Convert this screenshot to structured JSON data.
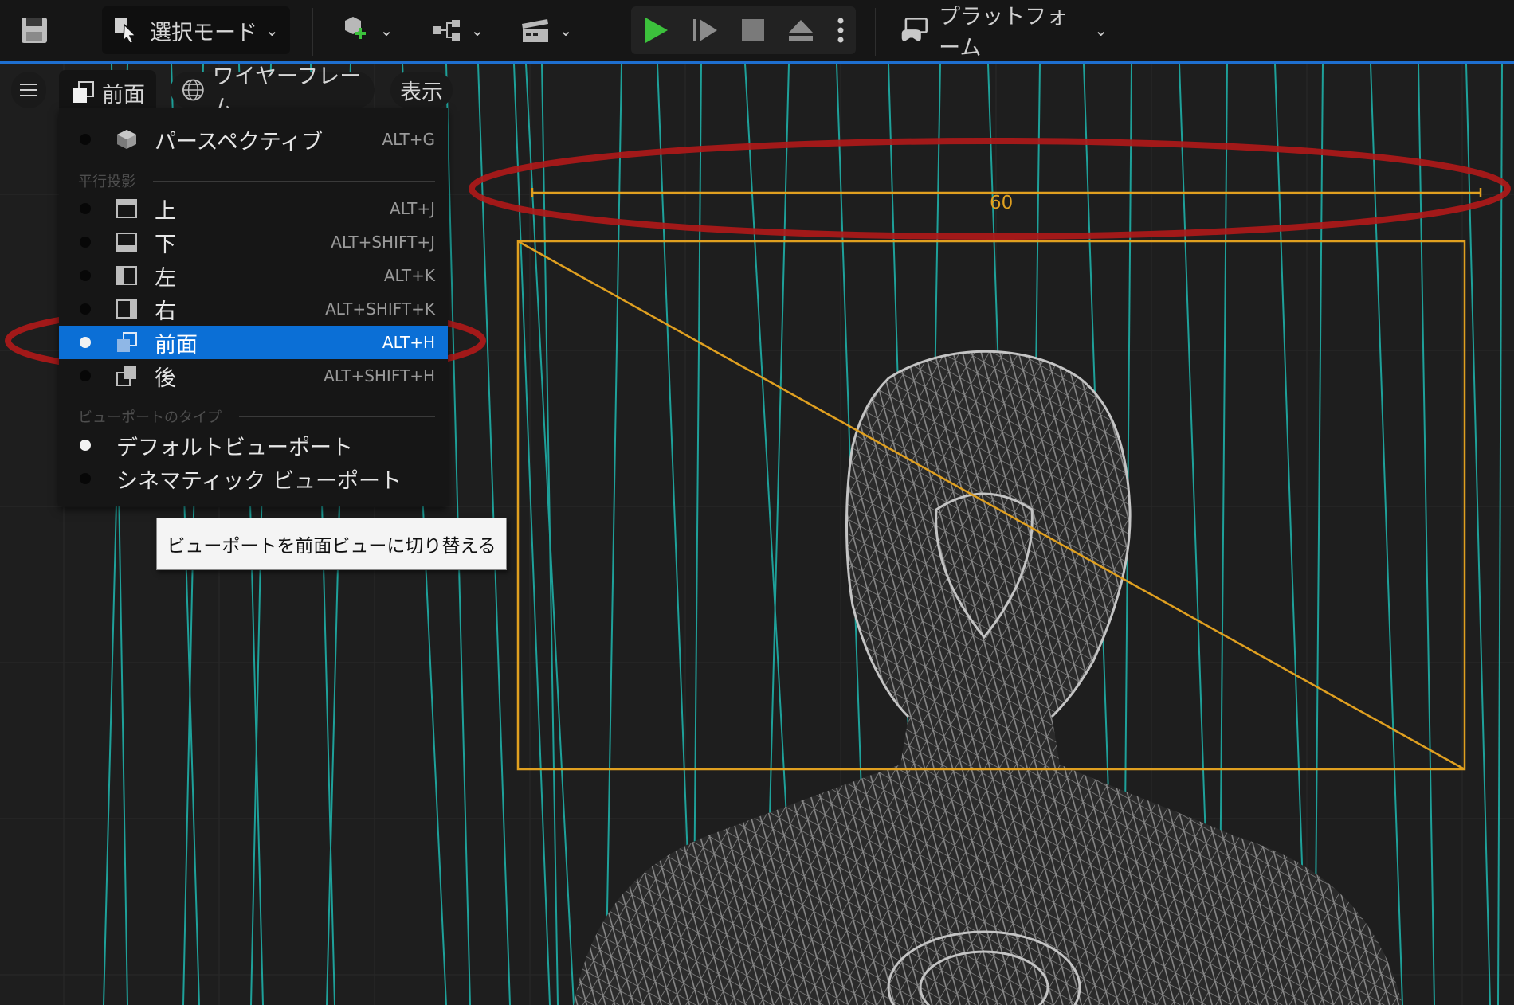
{
  "toolbar": {
    "mode_label": "選択モード",
    "platform_label": "プラットフォーム"
  },
  "viewport_bar": {
    "view_label": "前面",
    "wireframe_label": "ワイヤーフレーム",
    "show_label": "表示"
  },
  "view_menu": {
    "perspective": {
      "label": "パースペクティブ",
      "shortcut": "ALT+G"
    },
    "ortho_header": "平行投影",
    "ortho_items": [
      {
        "label": "上",
        "shortcut": "ALT+J",
        "icon": "top-view-icon"
      },
      {
        "label": "下",
        "shortcut": "ALT+SHIFT+J",
        "icon": "bottom-view-icon"
      },
      {
        "label": "左",
        "shortcut": "ALT+K",
        "icon": "left-view-icon"
      },
      {
        "label": "右",
        "shortcut": "ALT+SHIFT+K",
        "icon": "right-view-icon"
      },
      {
        "label": "前面",
        "shortcut": "ALT+H",
        "icon": "front-view-icon",
        "selected": true
      },
      {
        "label": "後",
        "shortcut": "ALT+SHIFT+H",
        "icon": "back-view-icon"
      }
    ],
    "type_header": "ビューポートのタイプ",
    "type_items": [
      {
        "label": "デフォルトビューポート",
        "selected": true
      },
      {
        "label": "シネマティック ビューポート",
        "selected": false
      }
    ]
  },
  "tooltip": "ビューポートを前面ビューに切り替える",
  "measurement": "60",
  "colors": {
    "accent": "#0b6fd6",
    "play": "#3cc13c",
    "measure": "#e0a020",
    "annotation": "#b01818",
    "wire": "#a8a8a8",
    "grid": "#1fb8b0"
  }
}
